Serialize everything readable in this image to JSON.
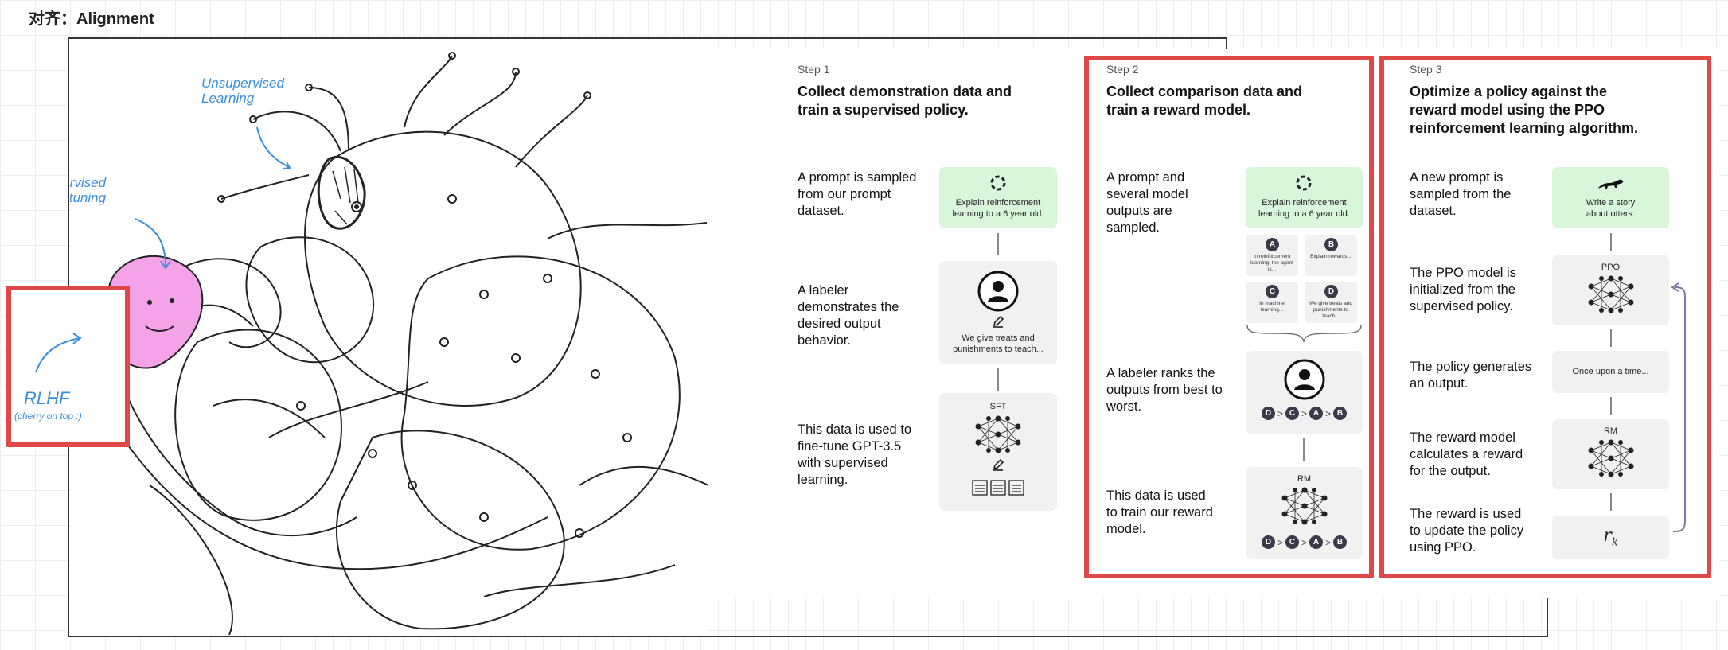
{
  "page_title": "对齐：Alignment",
  "illustration": {
    "unsupervised_label": "Unsupervised Learning",
    "supervised_label": "Supervised Fine-tuning",
    "rlhf_label": "RLHF",
    "rlhf_sub": "(cherry on top :)"
  },
  "step1": {
    "label": "Step 1",
    "title": "Collect demonstration data and train a supervised policy.",
    "items": [
      {
        "desc": "A prompt is sampled from our prompt dataset.",
        "card": "Explain reinforcement learning to a 6 year old."
      },
      {
        "desc": "A labeler demonstrates the desired output behavior.",
        "card": "We give treats and punishments to teach..."
      },
      {
        "desc": "This data is used to fine-tune GPT-3.5 with supervised learning.",
        "card": "SFT"
      }
    ]
  },
  "step2": {
    "label": "Step 2",
    "title": "Collect comparison data and train a reward model.",
    "items": [
      {
        "desc": "A prompt and several model outputs are sampled.",
        "card": "Explain reinforcement learning to a 6 year old."
      },
      {
        "desc": "A labeler ranks the outputs from best to worst."
      },
      {
        "desc": "This data is used to train our reward model.",
        "card": "RM"
      }
    ],
    "outputs": [
      {
        "badge": "A",
        "text": "In reinforcement learning, the agent is..."
      },
      {
        "badge": "B",
        "text": "Explain rewards..."
      },
      {
        "badge": "C",
        "text": "In machine learning..."
      },
      {
        "badge": "D",
        "text": "We give treats and punishments to teach..."
      }
    ],
    "ranking": [
      "D",
      "C",
      "A",
      "B"
    ],
    "ranking_sep": ">"
  },
  "step3": {
    "label": "Step 3",
    "title": "Optimize a policy against the reward model using the PPO reinforcement learning algorithm.",
    "items": [
      {
        "desc": "A new prompt is sampled from the dataset.",
        "card": "Write a story about otters."
      },
      {
        "desc": "The PPO model is initialized from the supervised policy.",
        "card": "PPO"
      },
      {
        "desc": "The policy generates an output.",
        "card": "Once upon a time..."
      },
      {
        "desc": "The reward model calculates a reward for the output.",
        "card": "RM"
      },
      {
        "desc": "The reward is used to update the policy using PPO.",
        "card": "r",
        "card_sub": "k"
      }
    ]
  },
  "colors": {
    "highlight_red": "#e04848",
    "card_green": "#d9f6da",
    "card_gray": "#f1f1f1",
    "sketch_pink": "#f5a3e8",
    "sketch_yellow": "#f7e35a",
    "label_blue": "#3b8ed8"
  }
}
